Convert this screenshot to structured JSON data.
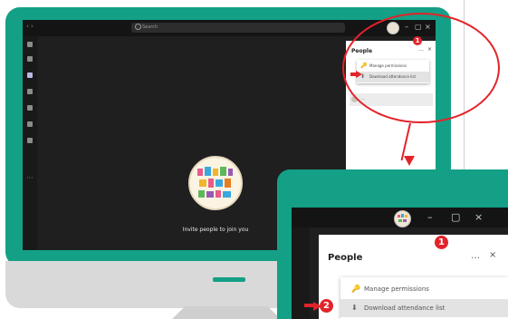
{
  "main_window": {
    "search_placeholder": "Search",
    "invite_text": "Invite people to join you"
  },
  "people_panel": {
    "title": "People",
    "more_icon": "…",
    "close_icon": "×",
    "menu_items": [
      {
        "icon": "key-icon",
        "glyph": "🔑",
        "label": "Manage permissions"
      },
      {
        "icon": "download-icon",
        "glyph": "⬇",
        "label": "Download attendance list"
      }
    ],
    "participant_row_label": "…"
  },
  "zoom_inset": {
    "title": "People",
    "more_icon": "…",
    "close_icon": "×",
    "menu_items": [
      {
        "icon": "key-icon",
        "glyph": "🔑",
        "label": "Manage permissions"
      },
      {
        "icon": "download-icon",
        "glyph": "⬇",
        "label": "Download attendance list"
      }
    ]
  },
  "annotations": {
    "step1": "1",
    "step2": "2",
    "color": "#e3232a"
  },
  "colors": {
    "monitor_frame": "#13a086",
    "app_background": "#1f1f1f",
    "panel_background": "#ffffff"
  }
}
